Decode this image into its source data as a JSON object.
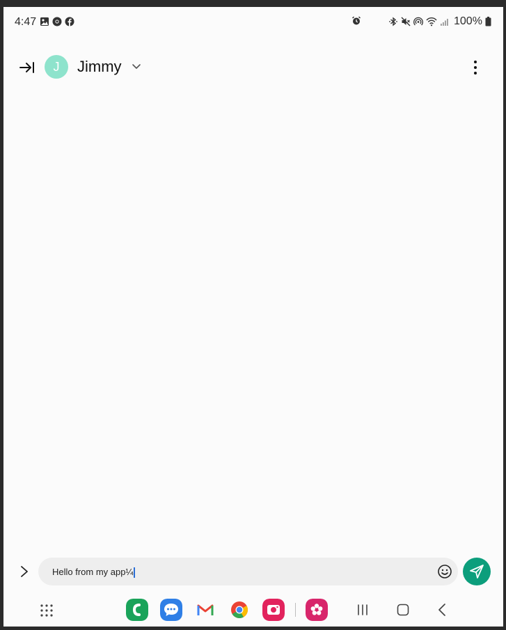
{
  "status_bar": {
    "time": "4:47",
    "battery_percent": "100%",
    "left_icons": [
      "image-icon",
      "chrome-icon",
      "facebook-icon"
    ],
    "right_icons": [
      "alarm-icon",
      "bluetooth-icon",
      "mute-icon",
      "hotspot-icon",
      "wifi-icon",
      "signal-icon",
      "battery-icon"
    ]
  },
  "header": {
    "avatar_initial": "J",
    "contact_name": "Jimmy",
    "avatar_color": "#8ee3cc"
  },
  "composer": {
    "message_text": "Hello from my app¼",
    "send_color": "#0c9e7c"
  },
  "dock": {
    "apps": [
      "phone-app",
      "messages-app",
      "gmail-app",
      "chrome-app",
      "camera-app",
      "gallery-app"
    ]
  }
}
